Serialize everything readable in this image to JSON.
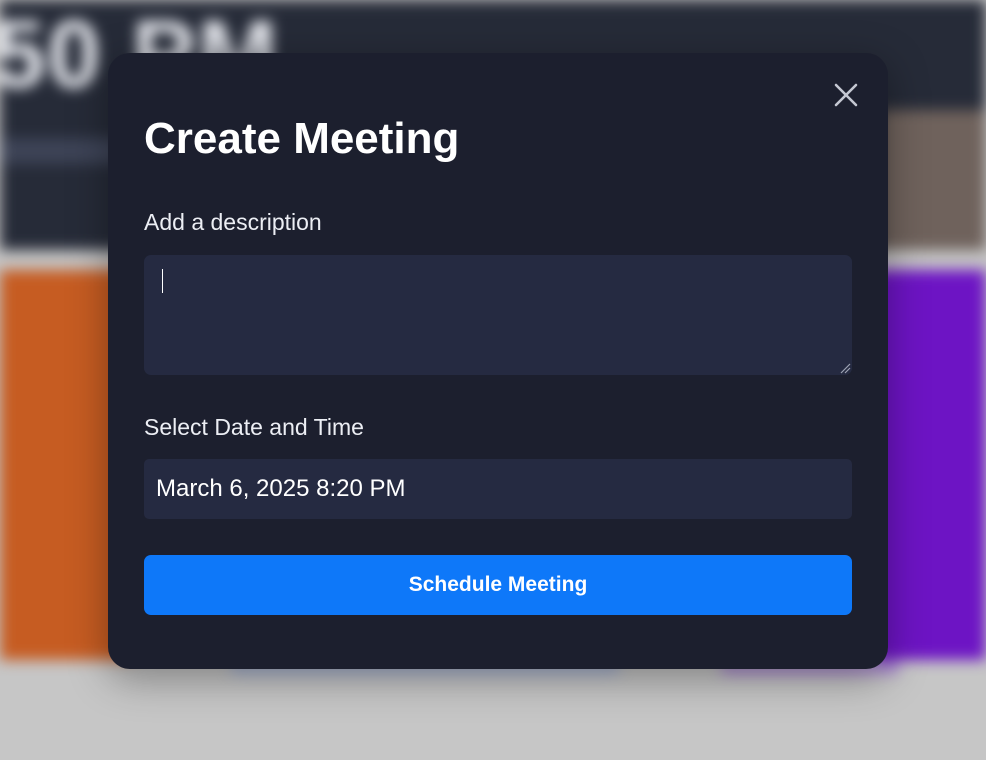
{
  "background": {
    "clock_text": "50 PM"
  },
  "modal": {
    "title": "Create Meeting",
    "close_icon": "close-icon",
    "description": {
      "label": "Add a description",
      "value": "",
      "placeholder": ""
    },
    "datetime": {
      "label": "Select Date and Time",
      "value": "March 6, 2025 8:20 PM"
    },
    "submit_label": "Schedule Meeting"
  },
  "colors": {
    "modal_bg": "#1c1f2e",
    "input_bg": "#252a41",
    "accent": "#0e78f9",
    "text": "#ffffff"
  }
}
